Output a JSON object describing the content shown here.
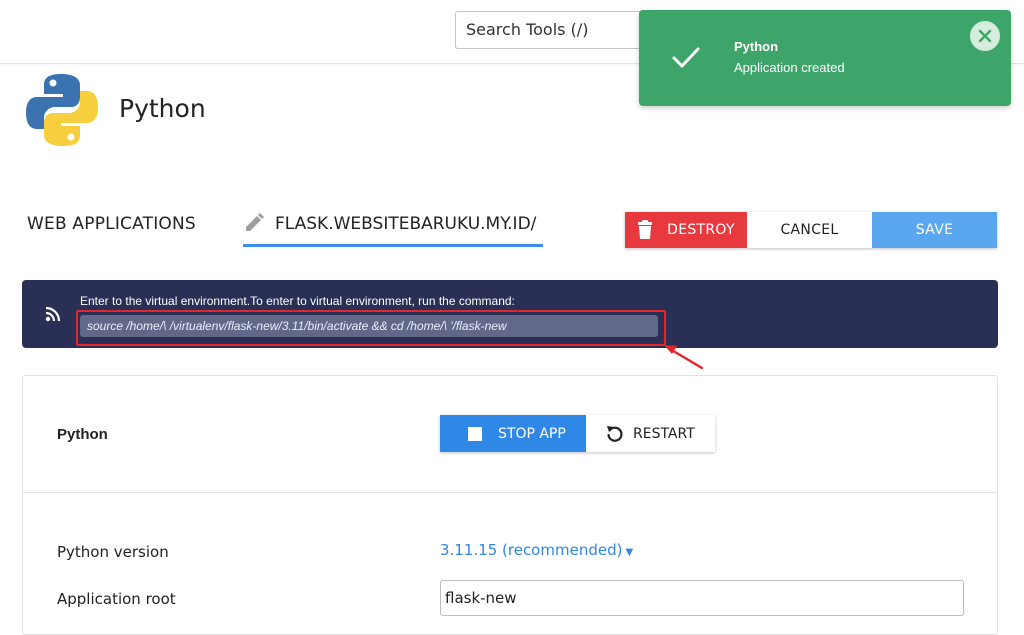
{
  "header": {
    "search_placeholder": "Search Tools (/)"
  },
  "toast": {
    "title": "Python",
    "message": "Application created",
    "color": "#3ea56a"
  },
  "app": {
    "title": "Python"
  },
  "tabs": {
    "web_applications": "WEB APPLICATIONS",
    "current_app": "FLASK.WEBSITEBARUKU.MY.ID/"
  },
  "actions": {
    "destroy": "DESTROY",
    "cancel": "CANCEL",
    "save": "SAVE"
  },
  "banner": {
    "message": "Enter to the virtual environment.To enter to virtual environment, run the command:",
    "command": "source /home/\\             /virtualenv/flask-new/3.11/bin/activate && cd /home/\\              '/flask-new"
  },
  "app_panel": {
    "section_title": "Python",
    "stop_label": "STOP APP",
    "restart_label": "RESTART",
    "python_version_label": "Python version",
    "python_version_value": "3.11.15 (recommended)",
    "app_root_label": "Application root",
    "app_root_value": "flask-new"
  },
  "colors": {
    "accent": "#2f88e6",
    "danger": "#e8393f",
    "banner_bg": "#2a3055",
    "highlight": "#e2262a"
  }
}
